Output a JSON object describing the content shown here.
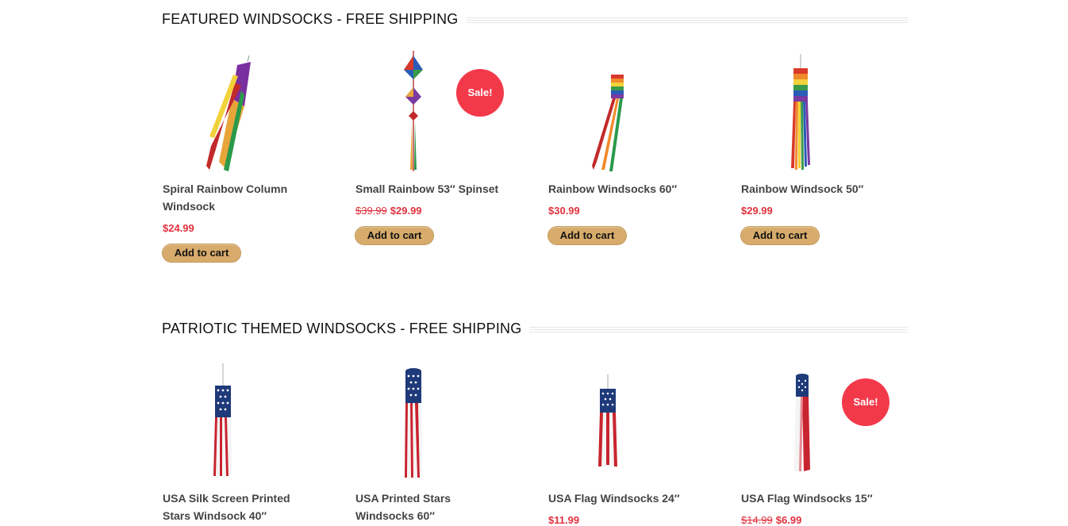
{
  "sections": [
    {
      "title": "FEATURED WINDSOCKS - FREE SHIPPING",
      "products": [
        {
          "name": "Spiral Rainbow Column Windsock",
          "price": "$24.99",
          "old_price": "",
          "button": "Add to cart",
          "sale": ""
        },
        {
          "name": "Small Rainbow 53″ Spinset",
          "price": "$29.99",
          "old_price": "$39.99",
          "button": "Add to cart",
          "sale": "Sale!"
        },
        {
          "name": "Rainbow Windsocks 60″",
          "price": "$30.99",
          "old_price": "",
          "button": "Add to cart",
          "sale": ""
        },
        {
          "name": "Rainbow Windsock 50″",
          "price": "$29.99",
          "old_price": "",
          "button": "Add to cart",
          "sale": ""
        }
      ]
    },
    {
      "title": "PATRIOTIC THEMED WINDSOCKS - FREE SHIPPING",
      "products": [
        {
          "name": "USA Silk Screen Printed Stars Windsock 40″",
          "price": "",
          "old_price": "",
          "button": "",
          "sale": ""
        },
        {
          "name": "USA Printed Stars Windsocks 60″",
          "price": "",
          "old_price": "",
          "button": "",
          "sale": ""
        },
        {
          "name": "USA Flag Windsocks 24″",
          "price": "$11.99",
          "old_price": "",
          "button": "",
          "sale": ""
        },
        {
          "name": "USA Flag Windsocks 15″",
          "price": "$6.99",
          "old_price": "$14.99",
          "button": "",
          "sale": "Sale!"
        }
      ]
    }
  ],
  "colors": {
    "sale_badge": "#f2394a",
    "price": "#e0313e",
    "button": "#d7ab6b"
  }
}
